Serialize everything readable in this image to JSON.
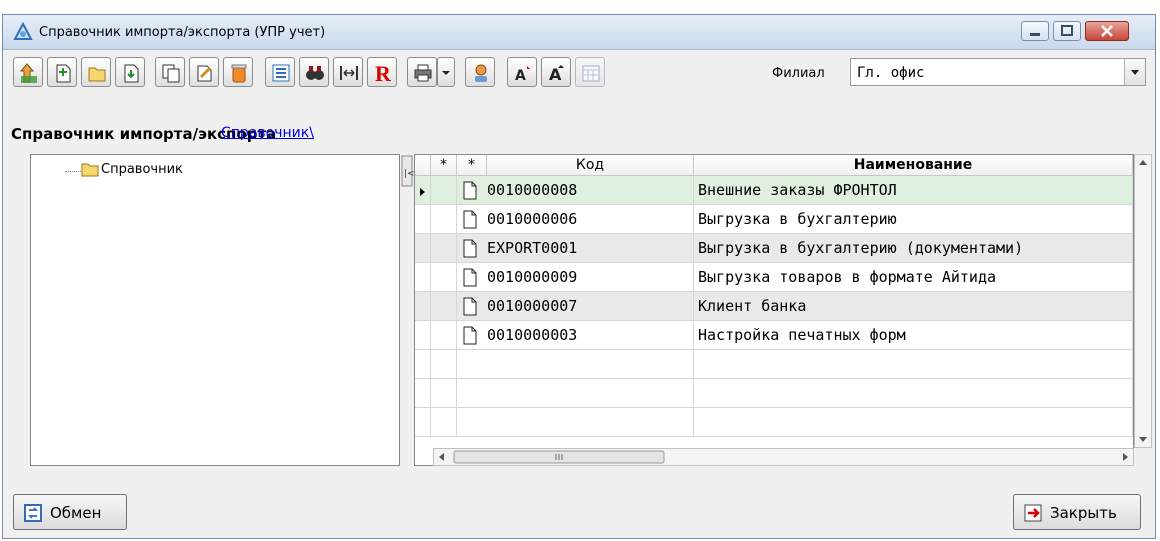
{
  "window": {
    "title": "Справочник импорта/экспорта (УПР учет)"
  },
  "toolbar": {
    "buttons": [
      "level-up-icon",
      "add-item-icon",
      "add-folder-icon",
      "save-icon",
      "copy-icon",
      "edit-icon",
      "delete-icon",
      "list-view-icon",
      "find-icon",
      "columns-icon",
      "report-r-icon",
      "print-icon",
      "dropdown-arrow-icon",
      "user-icon",
      "font-increase-icon",
      "font-decrease-icon",
      "calendar-icon"
    ],
    "filial_label": "Филиал",
    "filial_value": "Гл. офис"
  },
  "breadcrumb": {
    "heading": "Справочник импорта/экспорта",
    "link": "Справочник\\"
  },
  "tree": {
    "root_label": "Справочник"
  },
  "grid": {
    "headers": {
      "mark1": "*",
      "mark2": "*",
      "code": "Код",
      "name": "Наименование"
    },
    "rows": [
      {
        "code": "0010000008",
        "name": "Внешние заказы ФРОНТОЛ"
      },
      {
        "code": "0010000006",
        "name": "Выгрузка  в бухгалтерию"
      },
      {
        "code": "EXPORT0001",
        "name": "Выгрузка  в бухгалтерию (документами)"
      },
      {
        "code": "0010000009",
        "name": "Выгрузка товаров в формате Айтида"
      },
      {
        "code": "0010000007",
        "name": "Клиент банка"
      },
      {
        "code": "0010000003",
        "name": "Настройка печатных форм"
      }
    ],
    "selected_row_color": "#dff0df",
    "alt_row_color": "#e9e9e9"
  },
  "footer": {
    "exchange_label": "Обмен",
    "close_label": "Закрыть"
  },
  "colors": {
    "accent_red": "#d80000",
    "link": "#0000ee"
  }
}
